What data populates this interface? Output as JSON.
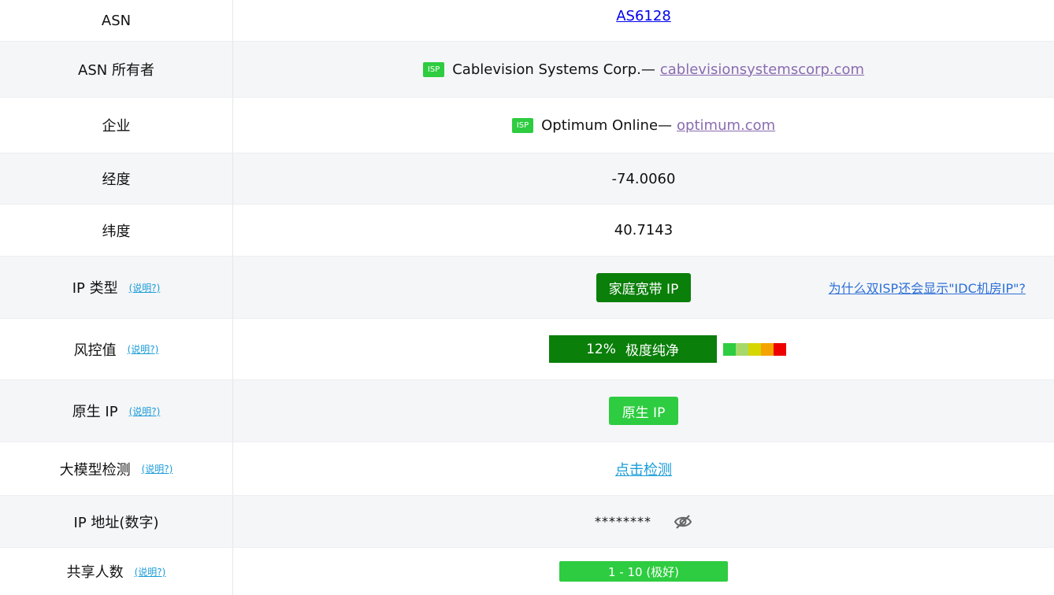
{
  "rows": {
    "asn": {
      "label": "ASN",
      "value": "AS6128"
    },
    "asn_owner": {
      "label": "ASN 所有者",
      "badge": "ISP",
      "name": "Cablevision Systems Corp.—",
      "domain": "cablevisionsystemscorp.com"
    },
    "company": {
      "label": "企业",
      "badge": "ISP",
      "name": "Optimum Online—",
      "domain": "optimum.com"
    },
    "longitude": {
      "label": "经度",
      "value": "-74.0060"
    },
    "latitude": {
      "label": "纬度",
      "value": "40.7143"
    },
    "ip_type": {
      "label": "IP 类型",
      "help": "(说明?)",
      "value": "家庭宽带 IP",
      "side_link": "为什么双ISP还会显示\"IDC机房IP\"?"
    },
    "risk": {
      "label": "风控值",
      "help": "(说明?)",
      "percent": "12%",
      "status": "极度纯净",
      "scale_colors": [
        "#2ecc40",
        "#a6d96a",
        "#d6d600",
        "#f5a300",
        "#ee0000"
      ]
    },
    "native_ip": {
      "label": "原生 IP",
      "help": "(说明?)",
      "value": "原生 IP"
    },
    "llm_detect": {
      "label": "大模型检测",
      "help": "(说明?)",
      "link": "点击检测"
    },
    "ip_numeric": {
      "label": "IP 地址(数字)",
      "value": "********",
      "icon": "eye-off-icon"
    },
    "shared_users": {
      "label": "共享人数",
      "help": "(说明?)",
      "value": "1 - 10 (极好)"
    }
  },
  "colors": {
    "dark_green": "#0a7f0a",
    "bright_green": "#2ecc40",
    "row_alt_bg": "#f5f6f8",
    "help_blue": "#1a9cd8",
    "visited_purple": "#8a6bb0"
  }
}
